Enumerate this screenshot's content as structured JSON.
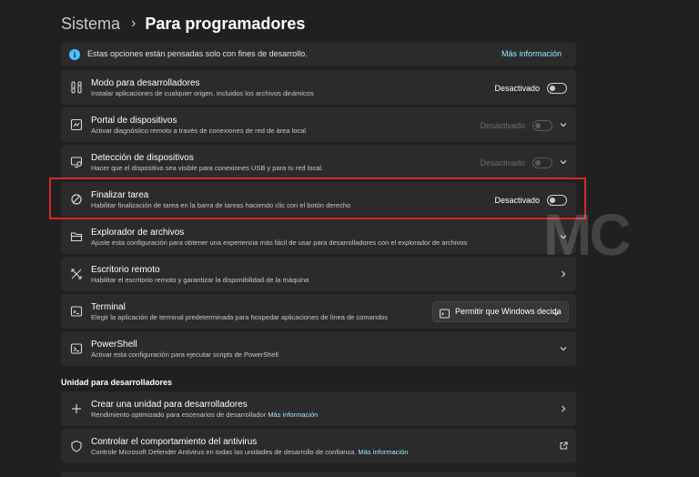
{
  "breadcrumb": {
    "parent": "Sistema",
    "separator": "›",
    "current": "Para programadores"
  },
  "info_bar": {
    "text": "Estas opciones están pensadas solo con fines de desarrollo.",
    "link": "Más información"
  },
  "settings": [
    {
      "title": "Modo para desarrolladores",
      "desc": "Instalar aplicaciones de cualquier origen, incluidos los archivos dinámicos",
      "state": "Desactivado",
      "icon": "developer-tools-icon"
    },
    {
      "title": "Portal de dispositivos",
      "desc": "Activar diagnóstico remoto a través de conexiones de red de área local",
      "state": "Desactivado",
      "icon": "device-portal-icon"
    },
    {
      "title": "Detección de dispositivos",
      "desc": "Hacer que el dispositivo sea visible para conexiones USB y para tu red local.",
      "state": "Desactivado",
      "icon": "device-discovery-icon"
    },
    {
      "title": "Finalizar tarea",
      "desc": "Habilitar finalización de tarea en la barra de tareas haciendo clic con el botón derecho",
      "state": "Desactivado",
      "icon": "end-task-icon"
    },
    {
      "title": "Explorador de archivos",
      "desc": "Ajuste esta configuración para obtener una experiencia más fácil de usar para desarrolladores con el explorador de archivos",
      "icon": "file-explorer-icon"
    },
    {
      "title": "Escritorio remoto",
      "desc": "Habilitar el escritorio remoto y garantizar la disponibilidad de la máquina",
      "icon": "remote-desktop-icon"
    },
    {
      "title": "Terminal",
      "desc": "Elegir la aplicación de terminal predeterminada para hospedar aplicaciones de línea de comandos",
      "dropdown": "Permitir que Windows decida",
      "icon": "terminal-icon"
    },
    {
      "title": "PowerShell",
      "desc": "Activar esta configuración para ejecutar scripts de PowerShell",
      "icon": "powershell-icon"
    }
  ],
  "section_dev_drive": "Unidad para desarrolladores",
  "dev_drive": [
    {
      "title": "Crear una unidad para desarrolladores",
      "desc": "Rendimiento optimizado para escenarios de desarrollador",
      "link": "Más información",
      "icon": "plus-icon"
    },
    {
      "title": "Controlar el comportamiento del antivirus",
      "desc": "Controle Microsoft Defender Antivirus en todas las unidades de desarrollo de confianza.",
      "link": "Más información",
      "icon": "shield-icon"
    }
  ],
  "watermark": "MC",
  "colors": {
    "background": "#202020",
    "card": "#2b2b2b",
    "accent": "#4cc2ff",
    "link": "#99ebff",
    "highlight": "#d6282b"
  }
}
